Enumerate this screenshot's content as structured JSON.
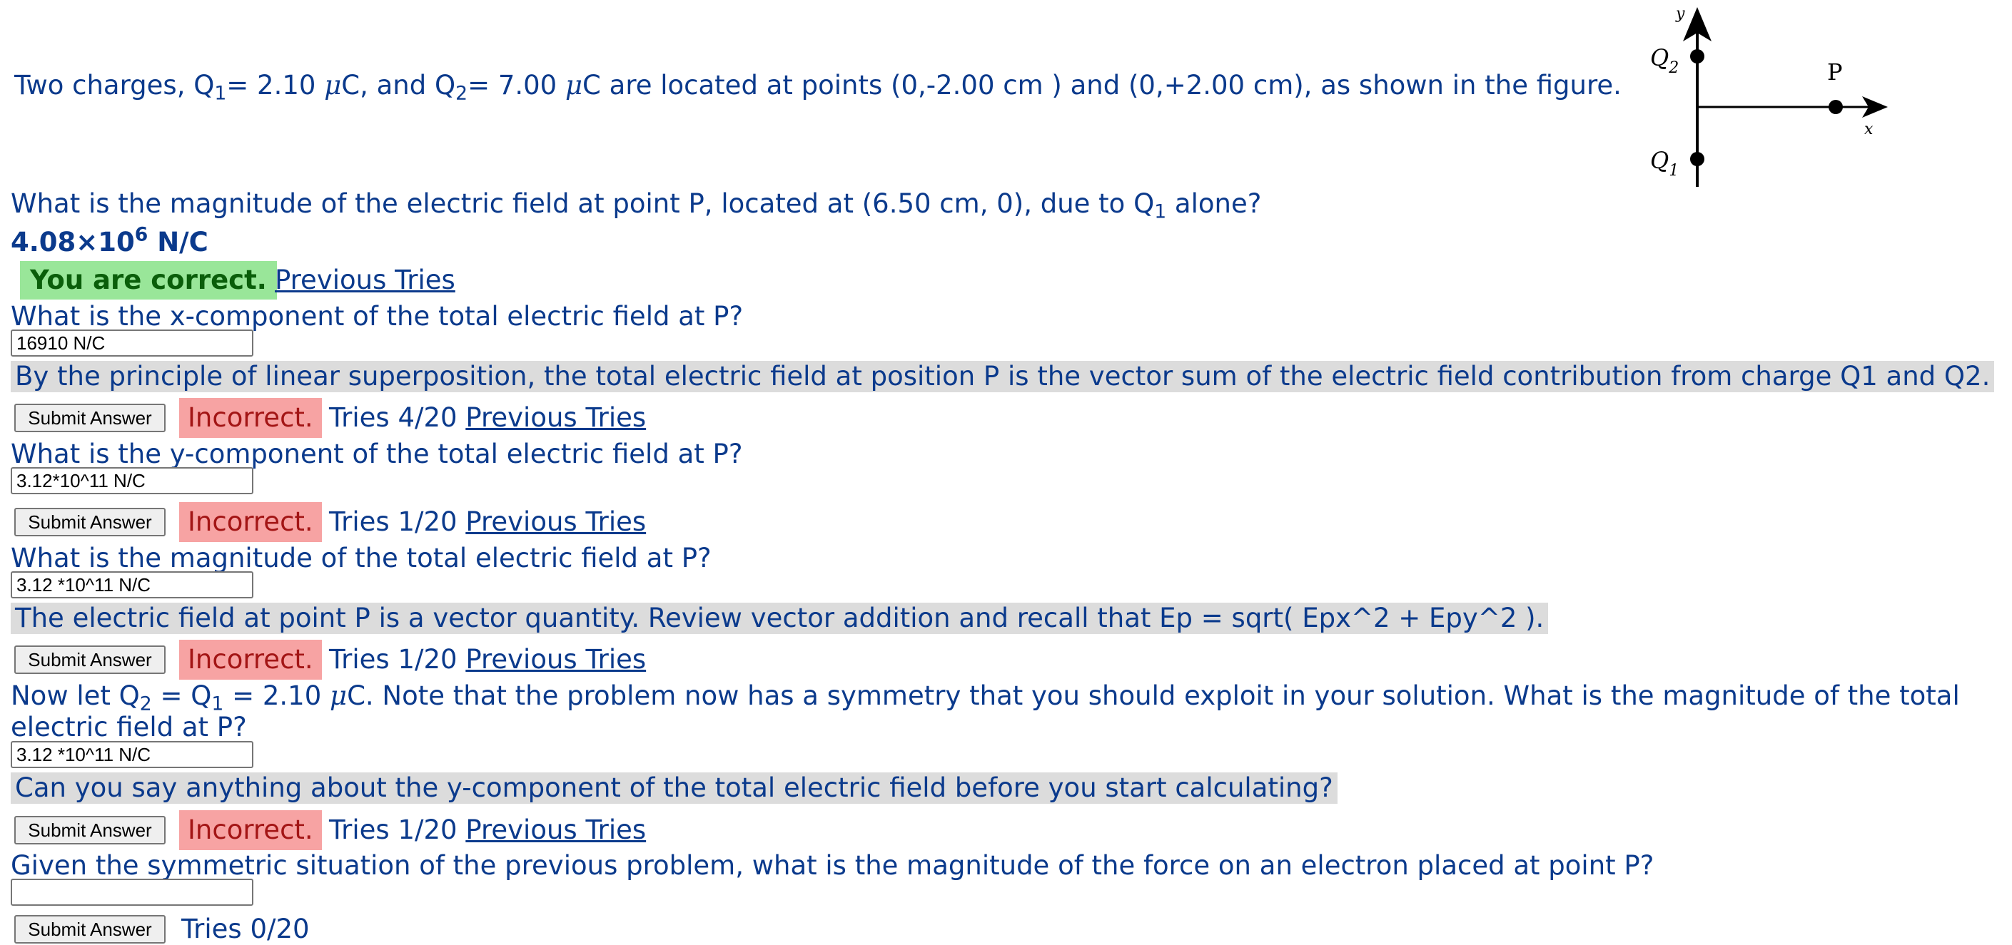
{
  "problem": {
    "intro_a": "Two charges, Q",
    "intro_b": "= 2.10 ",
    "intro_c": "C, and Q",
    "intro_d": "= 7.00 ",
    "intro_e": "C are located at points (0,-2.00 cm ) and (0,+2.00 cm), as shown in the figure.",
    "sub1": "1",
    "sub2": "2",
    "mu": "μ"
  },
  "figure": {
    "y_label": "y",
    "x_label": "x",
    "q2_label": "Q",
    "q2_sub": "2",
    "q1_label": "Q",
    "q1_sub": "1",
    "p_label": "P"
  },
  "q1": {
    "question_a": "What is the magnitude of the electric field at point P, located at (6.50 cm, 0), due to Q",
    "question_sub": "1",
    "question_b": " alone?",
    "answer_base": "4.08×10",
    "answer_exp": "6",
    "answer_unit": " N/C",
    "status": "You are correct.",
    "prev_tries": "Previous Tries"
  },
  "q2": {
    "question": "What is the x-component of the total electric field at P?",
    "input_value": "16910 N/C",
    "hint": "By the principle of linear superposition, the total electric field at position P is the vector sum of the electric field contribution from charge Q1 and Q2.",
    "submit": "Submit Answer",
    "status": "Incorrect.",
    "tries": "Tries 4/20",
    "prev_tries": "Previous Tries"
  },
  "q3": {
    "question": "What is the y-component of the total electric field at P?",
    "input_value": "3.12*10^11 N/C",
    "submit": "Submit Answer",
    "status": "Incorrect.",
    "tries": "Tries 1/20",
    "prev_tries": "Previous Tries"
  },
  "q4": {
    "question": "What is the magnitude of the total electric field at P?",
    "input_value": "3.12 *10^11 N/C",
    "hint": "The electric field at point P is a vector quantity. Review vector addition and recall that Ep = sqrt( Epx^2 + Epy^2 ).",
    "submit": "Submit Answer",
    "status": "Incorrect.",
    "tries": "Tries 1/20",
    "prev_tries": "Previous Tries"
  },
  "q5": {
    "question_a": "Now let Q",
    "sub_a": "2",
    "question_b": " = Q",
    "sub_b": "1",
    "question_c": " = 2.10 ",
    "question_d": "C. Note that the problem now has a symmetry that you should exploit in your solution. What is the magnitude of the total",
    "question_line2": "electric field at P?",
    "input_value": "3.12 *10^11 N/C",
    "hint": "Can you say anything about the y-component of the total electric field before you start calculating?",
    "submit": "Submit Answer",
    "status": "Incorrect.",
    "tries": "Tries 1/20",
    "prev_tries": "Previous Tries"
  },
  "q6": {
    "question": "Given the symmetric situation of the previous problem, what is the magnitude of the force on an electron placed at point P?",
    "input_value": "",
    "submit": "Submit Answer",
    "tries": "Tries 0/20"
  },
  "colors": {
    "text": "#0b3a8c",
    "correct_bg": "#99e699",
    "incorrect_bg": "#f7a3a3",
    "hint_bg": "#dcdcdc"
  }
}
